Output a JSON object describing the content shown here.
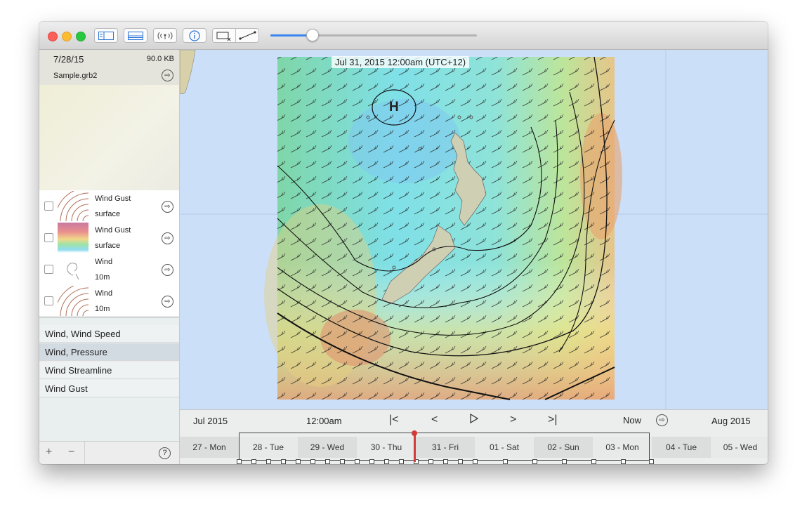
{
  "toolbar": {
    "buttons": [
      "sidebar-toggle",
      "bottom-panel-toggle",
      "broadcast",
      "info",
      "region-select",
      "route-line"
    ],
    "slider_value": 0.2
  },
  "sidebar": {
    "file": {
      "date": "7/28/15",
      "size": "90.0 KB",
      "name": "Sample.grb2"
    },
    "layers": [
      {
        "name": "Wind Gust",
        "level": "surface",
        "thumb": "contours"
      },
      {
        "name": "Wind Gust",
        "level": "surface",
        "thumb": "gradient"
      },
      {
        "name": "Wind",
        "level": "10m",
        "thumb": "streamline"
      },
      {
        "name": "Wind",
        "level": "10m",
        "thumb": "contours"
      }
    ],
    "presets": [
      "Wind, Wind Speed",
      "Wind, Pressure",
      "Wind Streamline",
      "Wind Gust"
    ],
    "selected_preset": 1,
    "footer": {
      "add": "+",
      "remove": "−",
      "help": "?"
    }
  },
  "map": {
    "date_label": "Jul 31, 2015 12:00am (UTC+12)",
    "pressure_label": "H"
  },
  "timeline": {
    "month_left": "Jul 2015",
    "time": "12:00am",
    "now": "Now",
    "month_right": "Aug 2015",
    "days": [
      "27 - Mon",
      "28 - Tue",
      "29 - Wed",
      "30 - Thu",
      "31 - Fri",
      "01 - Sat",
      "02 - Sun",
      "03 - Mon",
      "04 - Tue",
      "05 - Wed"
    ],
    "current_day_index": 4
  },
  "colors": {
    "accent": "#3a86f0",
    "marker": "#d33a3a",
    "ocean": "#cbdff9"
  }
}
